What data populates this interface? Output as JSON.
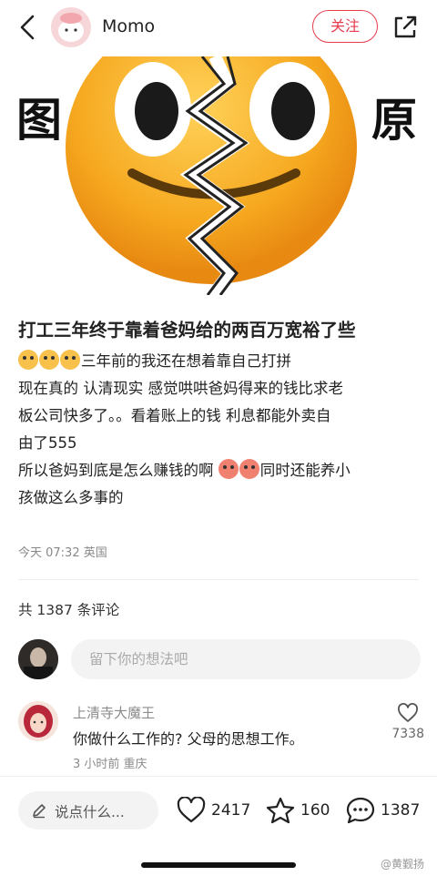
{
  "header": {
    "author": "Momo",
    "follow_label": "关注",
    "icons": [
      "back-arrow-icon",
      "share-icon"
    ]
  },
  "cover": {
    "left_char": "图",
    "right_char": "原"
  },
  "post": {
    "title": "打工三年终于靠着爸妈给的两百万宽裕了些",
    "line1_text": "三年前的我还在想着靠自己打拼",
    "line2": "现在真的 认清现实 感觉哄哄爸妈得来的钱比求老",
    "line3": "板公司快多了。。看着账上的钱 利息都能外卖自",
    "line4": "由了555",
    "line5_text": "所以爸妈到底是怎么赚钱的啊 ",
    "line5_tail": "同时还能养小",
    "line6": "孩做这么多事的",
    "meta": "今天 07:32 英国"
  },
  "comments": {
    "count_label": "共 1387 条评论",
    "input_placeholder": "留下你的想法吧",
    "items": [
      {
        "name": "上清寺大魔王",
        "text": "你做什么工作的? 父母的思想工作。",
        "meta": "3 小时前 重庆",
        "likes": "7338"
      }
    ]
  },
  "bottom_bar": {
    "say_label": "说点什么...",
    "likes": "2417",
    "stars": "160",
    "comments": "1387"
  },
  "watermark": "@黄觐扬",
  "colors": {
    "accent": "#e63c4e",
    "muted": "#8b8b8b"
  }
}
